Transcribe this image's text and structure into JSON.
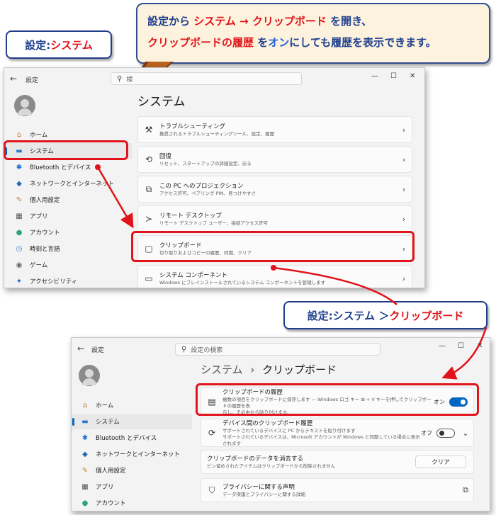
{
  "callout": {
    "l1_a": "設定から",
    "l1_b": "システム",
    "l1_arrow": "→",
    "l1_c": "クリップボード",
    "l1_d": "を開き、",
    "l2_a": "クリップボードの履歴",
    "l2_b": "を",
    "l2_c": "オン",
    "l2_d": "にしても履歴を表示できます。"
  },
  "tag1": {
    "a": "設定:",
    "b": "システム"
  },
  "tag2": {
    "a": "設定:システム ＞ ",
    "b": "クリップボード"
  },
  "win1": {
    "title": "設定",
    "search_placeholder": "検",
    "controls": {
      "min": "—",
      "max": "☐",
      "close": "✕"
    },
    "nav": [
      {
        "icon": "⌂",
        "label": "ホーム"
      },
      {
        "icon": "▬",
        "label": "システム"
      },
      {
        "icon": "✱",
        "label": "Bluetooth とデバイス"
      },
      {
        "icon": "◆",
        "label": "ネットワークとインターネット"
      },
      {
        "icon": "✎",
        "label": "個人用設定"
      },
      {
        "icon": "▦",
        "label": "アプリ"
      },
      {
        "icon": "●",
        "label": "アカウント"
      },
      {
        "icon": "◷",
        "label": "時刻と言語"
      },
      {
        "icon": "◉",
        "label": "ゲーム"
      },
      {
        "icon": "✦",
        "label": "アクセシビリティ"
      }
    ],
    "page_title": "システム",
    "cards": [
      {
        "icon": "⚒",
        "title": "トラブルシューティング",
        "sub": "推奨されるトラブルシューティングツール、設定、履歴"
      },
      {
        "icon": "⟲",
        "title": "回復",
        "sub": "リセット、スタートアップの詳細設定、戻る"
      },
      {
        "icon": "⧉",
        "title": "この PC へのプロジェクション",
        "sub": "アクセス許可、ペアリング PIN、見つけやすさ"
      },
      {
        "icon": "≻",
        "title": "リモート デスクトップ",
        "sub": "リモート デスクトップ ユーザー、接続アクセス許可"
      },
      {
        "icon": "▢",
        "title": "クリップボード",
        "sub": "切り取りおよびコピーの履歴、同期、クリア"
      },
      {
        "icon": "▭",
        "title": "システム コンポーネント",
        "sub": "Windows にプレインストールされているシステム コンポーネントを管理します"
      }
    ],
    "chevron": "›"
  },
  "win2": {
    "title": "設定",
    "search_placeholder": "設定の検索",
    "controls": {
      "min": "—",
      "max": "☐",
      "close": "✕"
    },
    "nav": [
      {
        "icon": "⌂",
        "label": "ホーム"
      },
      {
        "icon": "▬",
        "label": "システム"
      },
      {
        "icon": "✱",
        "label": "Bluetooth とデバイス"
      },
      {
        "icon": "◆",
        "label": "ネットワークとインターネット"
      },
      {
        "icon": "✎",
        "label": "個人用設定"
      },
      {
        "icon": "▦",
        "label": "アプリ"
      },
      {
        "icon": "●",
        "label": "アカウント"
      }
    ],
    "breadcrumb": {
      "parent": "システム",
      "sep": "›",
      "current": "クリップボード"
    },
    "history": {
      "icon": "▤",
      "title": "クリップボードの履歴",
      "sub1": "複数の項目をクリップボードに保存します — Windows ロゴ キー ⊞ + V キーを押してクリップボードの履歴を表",
      "sub2": "示し、その中から貼り付けます。",
      "state": "オン"
    },
    "sync": {
      "icon": "⟳",
      "title": "デバイス間のクリップボード履歴",
      "sub1": "サポートされているデバイスに PC からテキストを貼り付けます",
      "sub2": "サポートされているデバイスは、Microsoft アカウントが Windows と同期している場合に表示されます",
      "state": "オフ",
      "expand": "⌄"
    },
    "clear": {
      "title": "クリップボードのデータを消去する",
      "sub": "ピン留めされたアイテムはクリップボードから削除されません",
      "button": "クリア"
    },
    "privacy": {
      "icon": "⛉",
      "title": "プライバシーに関する声明",
      "sub": "データ保護とプライバシーに関する詳細",
      "external": "⧉"
    }
  },
  "colors": {
    "accent_red": "#e0141a",
    "navy": "#203e8a",
    "toggle_blue": "#0067c0"
  }
}
